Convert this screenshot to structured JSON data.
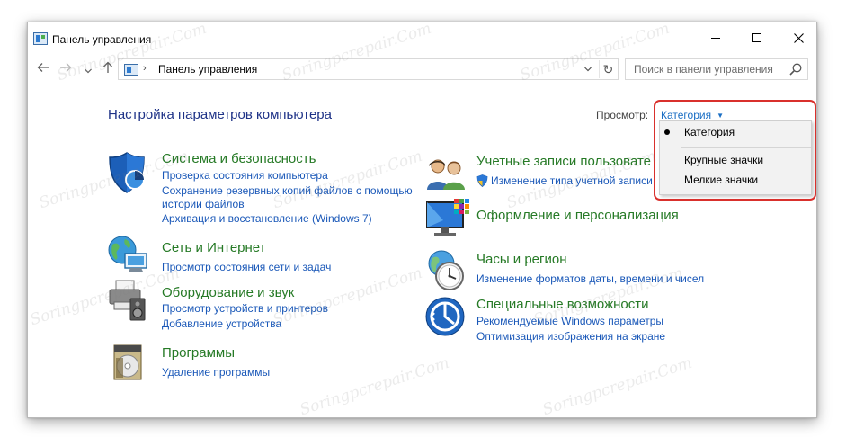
{
  "window": {
    "title": "Панель управления"
  },
  "address_bar": {
    "separator": "›",
    "path": "Панель управления",
    "refresh_glyph": "↻"
  },
  "search": {
    "placeholder": "Поиск в панели управления"
  },
  "content": {
    "heading": "Настройка параметров компьютера",
    "view_by_label": "Просмотр:",
    "view_by_value": "Категория"
  },
  "categories_left": [
    {
      "title": "Система и безопасность",
      "icon": "shield-security-icon",
      "links": [
        "Проверка состояния компьютера",
        "Сохранение резервных копий файлов с помощью",
        "истории файлов",
        "Архивация и восстановление (Windows 7)"
      ]
    },
    {
      "title": "Сеть и Интернет",
      "icon": "network-globe-icon",
      "links": [
        "Просмотр состояния сети и задач"
      ]
    },
    {
      "title": "Оборудование и звук",
      "icon": "printer-speaker-icon",
      "links": [
        "Просмотр устройств и принтеров",
        "Добавление устройства"
      ]
    },
    {
      "title": "Программы",
      "icon": "programs-disc-icon",
      "links": [
        "Удаление программы"
      ]
    }
  ],
  "categories_right": [
    {
      "title": "Учетные записи пользовате",
      "icon": "user-accounts-icon",
      "links": [
        "Изменение типа учетной записи"
      ]
    },
    {
      "title": "Оформление и персонализация",
      "icon": "monitor-palette-icon",
      "links": []
    },
    {
      "title": "Часы и регион",
      "icon": "clock-globe-icon",
      "links": [
        "Изменение форматов даты, времени и чисел"
      ]
    },
    {
      "title": "Специальные возможности",
      "icon": "ease-of-access-icon",
      "links": [
        "Рекомендуемые Windows параметры",
        "Оптимизация изображения на экране"
      ]
    }
  ],
  "view_dropdown": {
    "items": [
      "Категория",
      "Крупные значки",
      "Мелкие значки"
    ],
    "selected_index": 0
  },
  "watermark": "Soringpcrepair.Com",
  "colors": {
    "category_title": "#267a26",
    "link": "#1a58b8",
    "heading": "#1e3287",
    "highlight_outline": "#d9302c"
  }
}
